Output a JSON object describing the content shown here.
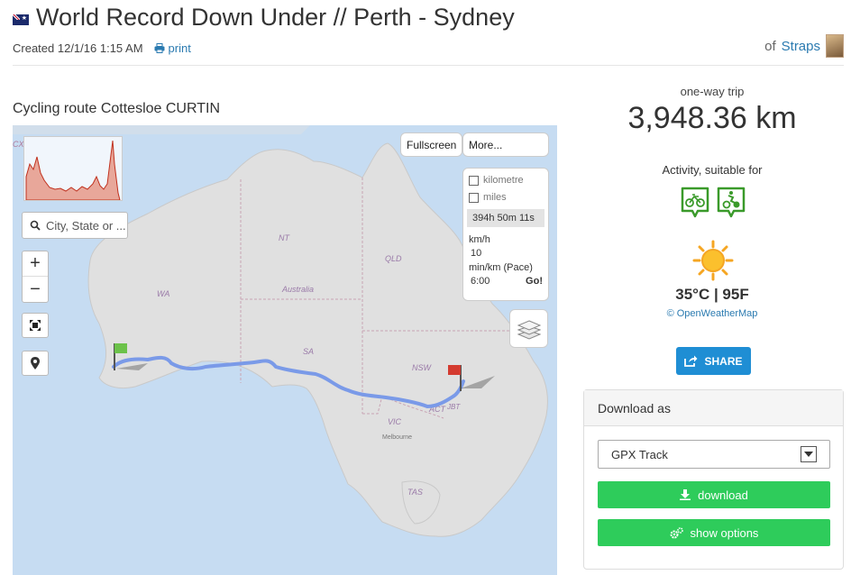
{
  "header": {
    "title": "World Record Down Under // Perth - Sydney",
    "created": "Created 12/1/16 1:15 AM",
    "print_label": "print",
    "author_prefix": "of",
    "author_name": "Straps"
  },
  "route": {
    "title": "Cycling route Cottesloe CURTIN"
  },
  "map": {
    "search_placeholder": "City, State or ...",
    "zoom_in": "+",
    "zoom_out": "−",
    "fullscreen_label": "Fullscreen",
    "more_label": "More...",
    "units": {
      "kilometre": "kilometre",
      "miles": "miles",
      "duration": "394h 50m 11s",
      "speed_label": "km/h",
      "speed_value": "10",
      "pace_label": "min/km (Pace)",
      "pace_value": "6:00",
      "go_label": "Go!"
    },
    "labels": {
      "nt": "NT",
      "qld": "QLD",
      "wa": "WA",
      "australia": "Australia",
      "sa": "SA",
      "nsw": "NSW",
      "vic": "VIC",
      "act": "ACT",
      "jbt": "JBT",
      "melbourne": "Melbourne",
      "tas": "TAS",
      "cx": "CX"
    }
  },
  "trip": {
    "type_label": "one-way trip",
    "distance": "3,948.36 km",
    "activity_label": "Activity, suitable for",
    "activity_icons": [
      "bicycle-icon",
      "mountain-bike-icon"
    ]
  },
  "weather": {
    "temperature": "35°C | 95F",
    "source": "© OpenWeatherMap"
  },
  "share": {
    "label": "SHARE"
  },
  "download": {
    "heading": "Download as",
    "format_selected": "GPX Track",
    "download_label": "download",
    "options_label": "show options"
  },
  "colors": {
    "link": "#2a7ab0",
    "share_button": "#1f8ed4",
    "green_button": "#2ecc5b",
    "route_line": "#7a9ae8",
    "land": "#e0e0e0",
    "sea": "#c6dcf2",
    "activity_icon": "#3a9a2a"
  }
}
